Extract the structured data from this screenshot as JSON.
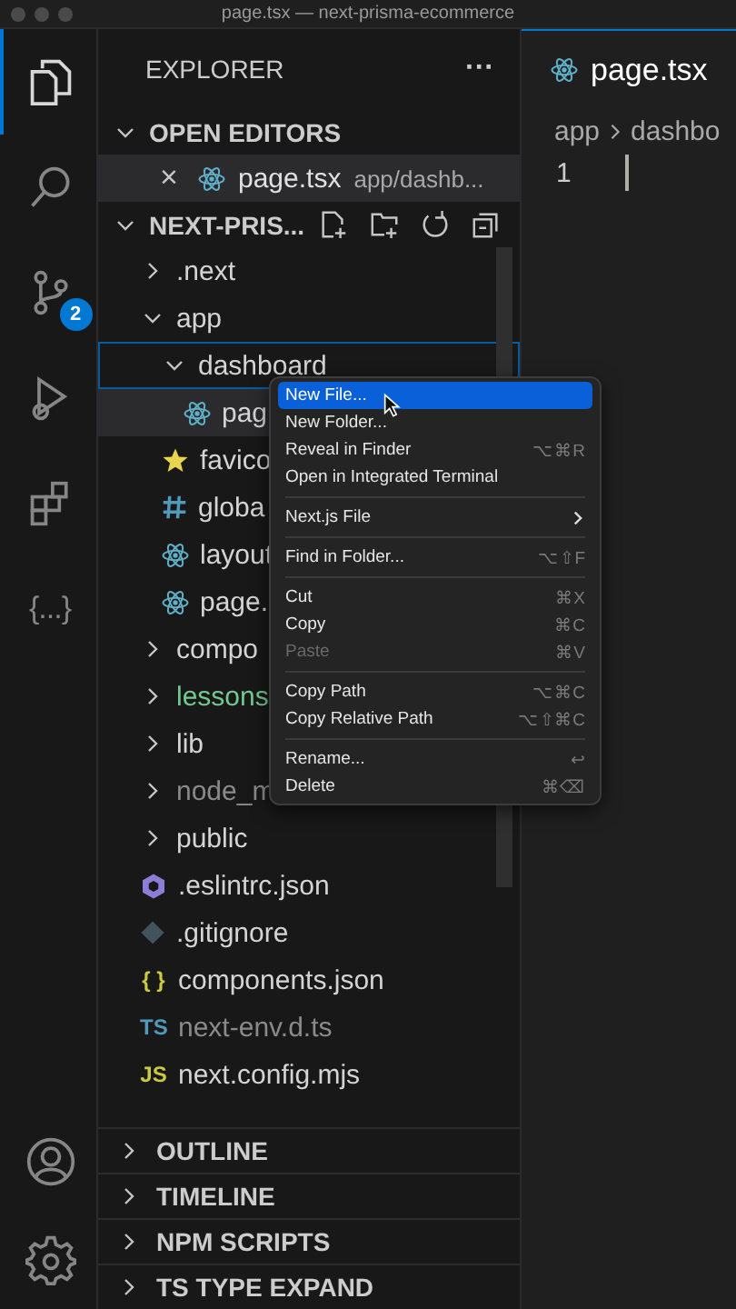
{
  "window": {
    "title": "page.tsx — next-prisma-ecommerce"
  },
  "activity_bar": {
    "items": [
      {
        "kind": "files",
        "selected": true
      },
      {
        "kind": "search",
        "selected": false
      },
      {
        "kind": "source-control",
        "selected": false,
        "badge": "2"
      },
      {
        "kind": "run",
        "selected": false
      },
      {
        "kind": "extensions",
        "selected": false
      },
      {
        "kind": "braces",
        "selected": false,
        "label": "{...}"
      }
    ],
    "bottom": [
      {
        "kind": "account"
      },
      {
        "kind": "settings"
      }
    ]
  },
  "sidebar": {
    "title": "EXPLORER",
    "more": "···",
    "open_editors": {
      "title": "OPEN EDITORS",
      "expanded": true,
      "items": [
        {
          "name": "page.tsx",
          "path": "app/dashb...",
          "close": "×",
          "active": true
        }
      ]
    },
    "project": {
      "title": "NEXT-PRIS...",
      "expanded": true,
      "tree": [
        {
          "label": ".next",
          "kind": "folder",
          "expanded": false,
          "ignored": false,
          "untracked": false,
          "selected": false,
          "active": false
        },
        {
          "label": "app",
          "kind": "folder",
          "expanded": true,
          "ignored": false,
          "untracked": false,
          "selected": false,
          "active": false,
          "children": [
            {
              "label": "dashboard",
              "kind": "folder",
              "expanded": true,
              "ignored": false,
              "untracked": false,
              "selected": true,
              "active": false,
              "children": [
                {
                  "label": "pag",
                  "kind": "react",
                  "ignored": false,
                  "untracked": false,
                  "selected": false,
                  "active": true
                }
              ]
            },
            {
              "label": "favico",
              "kind": "star",
              "ignored": false,
              "untracked": false,
              "selected": false,
              "active": false
            },
            {
              "label": "globa",
              "kind": "hash",
              "ignored": false,
              "untracked": false,
              "selected": false,
              "active": false
            },
            {
              "label": "layout",
              "kind": "react",
              "ignored": false,
              "untracked": false,
              "selected": false,
              "active": false
            },
            {
              "label": "page.",
              "kind": "react",
              "ignored": false,
              "untracked": false,
              "selected": false,
              "active": false
            }
          ]
        },
        {
          "label": "compo",
          "kind": "folder",
          "expanded": false,
          "ignored": false,
          "untracked": false,
          "selected": false,
          "active": false
        },
        {
          "label": "lessons",
          "kind": "folder",
          "expanded": false,
          "ignored": false,
          "untracked": true,
          "selected": false,
          "active": false
        },
        {
          "label": "lib",
          "kind": "folder",
          "expanded": false,
          "ignored": false,
          "untracked": false,
          "selected": false,
          "active": false
        },
        {
          "label": "node_m",
          "kind": "folder",
          "expanded": false,
          "ignored": true,
          "untracked": false,
          "selected": false,
          "active": false
        },
        {
          "label": "public",
          "kind": "folder",
          "expanded": false,
          "ignored": false,
          "untracked": false,
          "selected": false,
          "active": false
        },
        {
          "label": ".eslintrc.json",
          "kind": "eslint",
          "ignored": false,
          "untracked": false,
          "selected": false,
          "active": false
        },
        {
          "label": ".gitignore",
          "kind": "git",
          "ignored": false,
          "untracked": false,
          "selected": false,
          "active": false
        },
        {
          "label": "components.json",
          "kind": "json",
          "icon_text": "{ }",
          "ignored": false,
          "untracked": false,
          "selected": false,
          "active": false
        },
        {
          "label": "next-env.d.ts",
          "kind": "ts",
          "icon_text": "TS",
          "ignored": true,
          "untracked": false,
          "selected": false,
          "active": false
        },
        {
          "label": "next.config.mjs",
          "kind": "js",
          "icon_text": "JS",
          "ignored": false,
          "untracked": false,
          "selected": false,
          "active": false
        }
      ]
    },
    "panels": [
      {
        "title": "OUTLINE",
        "expanded": false
      },
      {
        "title": "TIMELINE",
        "expanded": false
      },
      {
        "title": "NPM SCRIPTS",
        "expanded": false
      },
      {
        "title": "TS TYPE EXPAND",
        "expanded": false
      }
    ]
  },
  "editor": {
    "tab": {
      "name": "page.tsx"
    },
    "breadcrumb": [
      "app",
      "dashbo"
    ],
    "line_numbers": [
      "1"
    ]
  },
  "context_menu": {
    "groups": [
      [
        {
          "label": "New File...",
          "selected": true,
          "disabled": false,
          "submenu": false
        },
        {
          "label": "New Folder...",
          "selected": false,
          "disabled": false,
          "submenu": false
        },
        {
          "label": "Reveal in Finder",
          "shortcut": "⌥⌘R",
          "selected": false,
          "disabled": false,
          "submenu": false
        },
        {
          "label": "Open in Integrated Terminal",
          "selected": false,
          "disabled": false,
          "submenu": false
        }
      ],
      [
        {
          "label": "Next.js File",
          "selected": false,
          "disabled": false,
          "submenu": true
        }
      ],
      [
        {
          "label": "Find in Folder...",
          "shortcut": "⌥⇧F",
          "selected": false,
          "disabled": false,
          "submenu": false
        }
      ],
      [
        {
          "label": "Cut",
          "shortcut": "⌘X",
          "selected": false,
          "disabled": false,
          "submenu": false
        },
        {
          "label": "Copy",
          "shortcut": "⌘C",
          "selected": false,
          "disabled": false,
          "submenu": false
        },
        {
          "label": "Paste",
          "shortcut": "⌘V",
          "selected": false,
          "disabled": true,
          "submenu": false
        }
      ],
      [
        {
          "label": "Copy Path",
          "shortcut": "⌥⌘C",
          "selected": false,
          "disabled": false,
          "submenu": false
        },
        {
          "label": "Copy Relative Path",
          "shortcut": "⌥⇧⌘C",
          "selected": false,
          "disabled": false,
          "submenu": false
        }
      ],
      [
        {
          "label": "Rename...",
          "shortcut": "↩",
          "selected": false,
          "disabled": false,
          "submenu": false
        },
        {
          "label": "Delete",
          "shortcut": "⌘⌫",
          "selected": false,
          "disabled": false,
          "submenu": false
        }
      ]
    ]
  }
}
